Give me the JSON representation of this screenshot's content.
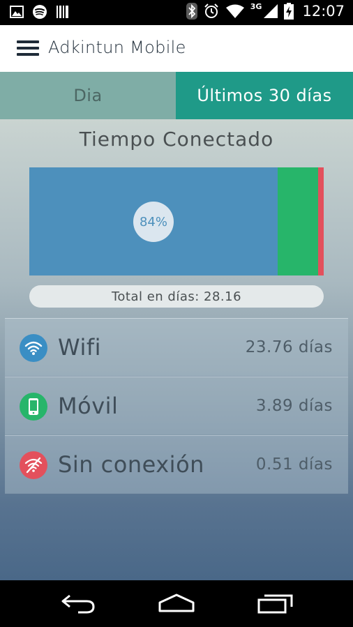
{
  "statusbar": {
    "network": "3G",
    "time": "12:07",
    "icons": [
      "image-icon",
      "spotify-icon",
      "barcode-icon",
      "bluetooth-icon",
      "alarm-icon",
      "wifi-signal-icon",
      "cell-signal-icon",
      "battery-charging-icon"
    ]
  },
  "appbar": {
    "title": "Adkintun Mobile"
  },
  "tabs": [
    {
      "label": "Dia",
      "selected": false
    },
    {
      "label": "Últimos 30 días",
      "selected": true
    }
  ],
  "section_title": "Tiempo Conectado",
  "usage_bar": {
    "highlight_label": "84%",
    "segments": [
      {
        "name": "Wifi",
        "fraction": 0.8438,
        "color": "#4d90bc"
      },
      {
        "name": "Móvil",
        "fraction": 0.1381,
        "color": "#27b56a"
      },
      {
        "name": "Sin conexión",
        "fraction": 0.0181,
        "color": "#e3505c"
      }
    ]
  },
  "total_label": "Total en días: 28.16",
  "rows": [
    {
      "label": "Wifi",
      "value": "23.76 días",
      "icon": "wifi-icon",
      "color": "#3a8ec4"
    },
    {
      "label": "Móvil",
      "value": "3.89 días",
      "icon": "phone-icon",
      "color": "#27b56a"
    },
    {
      "label": "Sin conexión",
      "value": "0.51 días",
      "icon": "no-wifi-icon",
      "color": "#e3505c"
    }
  ],
  "navbar": {
    "icons": [
      "back-icon",
      "home-icon",
      "recents-icon"
    ]
  }
}
